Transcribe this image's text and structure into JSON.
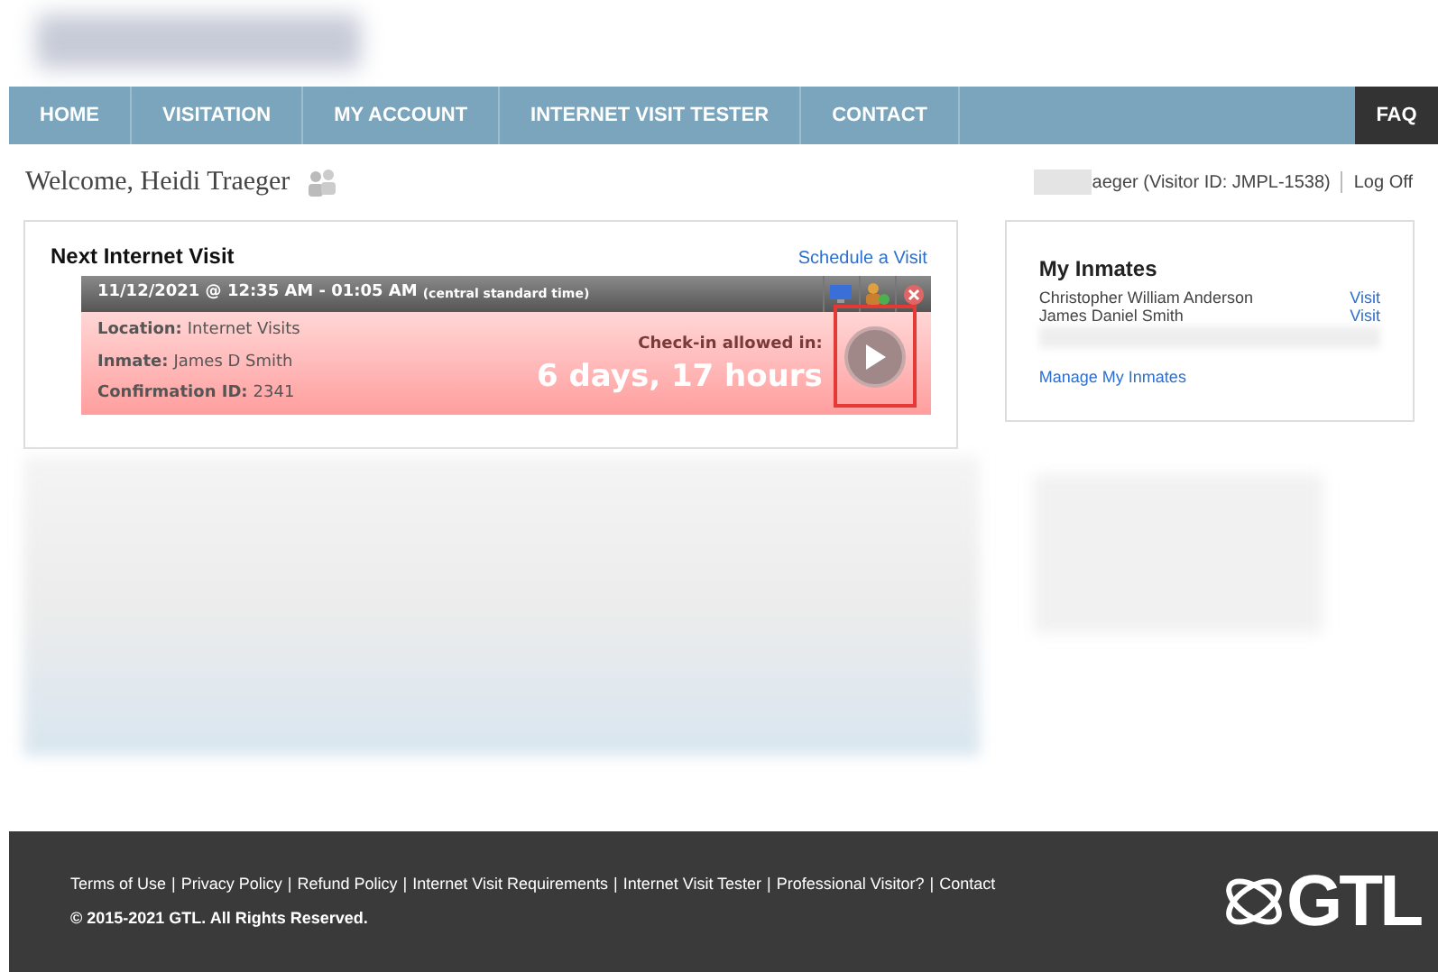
{
  "nav": {
    "items": [
      {
        "label": "HOME",
        "selected": false
      },
      {
        "label": "VISITATION",
        "selected": false
      },
      {
        "label": "MY ACCOUNT",
        "selected": false
      },
      {
        "label": "INTERNET VISIT TESTER",
        "selected": false
      },
      {
        "label": "CONTACT",
        "selected": false
      }
    ],
    "faq": "FAQ"
  },
  "welcome": "Welcome, Heidi Traeger",
  "user": {
    "visitor": "aeger (Visitor ID: JMPL-1538)",
    "logoff": "Log Off"
  },
  "next_visit": {
    "title": "Next Internet Visit",
    "schedule_link": "Schedule a Visit",
    "datetime": "11/12/2021 @ 12:35 AM - 01:05 AM",
    "timezone": "(central standard time)",
    "details": [
      {
        "label": "Location:",
        "value": "Internet Visits"
      },
      {
        "label": "Inmate:",
        "value": "James D Smith"
      },
      {
        "label": "Confirmation ID:",
        "value": "2341"
      }
    ],
    "checkin_label": "Check-in allowed in:",
    "countdown": "6 days, 17 hours"
  },
  "inmates": {
    "title": "My Inmates",
    "rows": [
      {
        "name": "Christopher William Anderson",
        "action": "Visit"
      },
      {
        "name": "James Daniel Smith",
        "action": "Visit"
      }
    ],
    "manage": "Manage My Inmates"
  },
  "footer": {
    "links": [
      "Terms of Use",
      "Privacy Policy",
      "Refund Policy",
      "Internet Visit Requirements",
      "Internet Visit Tester",
      "Professional Visitor?",
      "Contact"
    ],
    "separator": "|",
    "copyright": "© 2015-2021 GTL. All Rights Reserved.",
    "logo": "GTL"
  }
}
